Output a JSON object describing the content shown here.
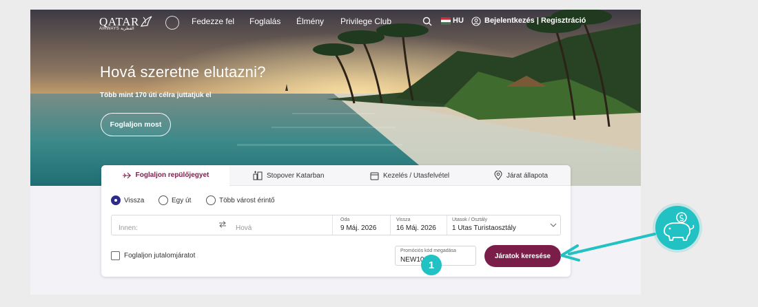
{
  "nav": {
    "logo_text": "QATAR",
    "logo_subtext": "AIRWAYS القطرية",
    "items": [
      {
        "label": "Fedezze fel"
      },
      {
        "label": "Foglalás"
      },
      {
        "label": "Élmény"
      },
      {
        "label": "Privilege Club"
      }
    ],
    "language": "HU",
    "login_label": "Bejelentkezés | Regisztráció",
    "icons": [
      "search-icon",
      "hungary-flag-icon",
      "user-icon",
      "oneworld-logo"
    ]
  },
  "hero": {
    "title": "Hová szeretne elutazni?",
    "subtitle": "Több mint 170 úti célra juttatjuk el",
    "cta_label": "Foglaljon most"
  },
  "booking": {
    "tabs": [
      {
        "label": "Foglaljon repülőjegyet",
        "icon": "plane-icon",
        "active": true
      },
      {
        "label": "Stopover Katarban",
        "icon": "stopover-icon",
        "active": false
      },
      {
        "label": "Kezelés / Utasfelvétel",
        "icon": "calendar-icon",
        "active": false
      },
      {
        "label": "Járat állapota",
        "icon": "location-pin-icon",
        "active": false
      }
    ],
    "trip_types": [
      {
        "label": "Vissza",
        "selected": true
      },
      {
        "label": "Egy út",
        "selected": false
      },
      {
        "label": "Több várost érintő",
        "selected": false
      }
    ],
    "from_placeholder": "Innen:",
    "to_placeholder": "Hová",
    "depart_label": "Oda",
    "depart_value": "9 Máj. 2026",
    "return_label": "Vissza",
    "return_value": "16 Máj. 2026",
    "pax_label": "Utasok / Osztály",
    "pax_value": "1 Utas Turistaosztály",
    "award_label": "Foglaljon jutalomjáratot",
    "promo_label": "Promóciós kód megadása",
    "promo_value": "NEW10",
    "search_label": "Járatok keresése"
  },
  "annotation": {
    "step_number": "1",
    "accent_color": "#22c1c3",
    "icon": "piggy-bank-icon"
  },
  "colors": {
    "brand": "#7b1d49",
    "radio_selected": "#2d2a8a"
  }
}
